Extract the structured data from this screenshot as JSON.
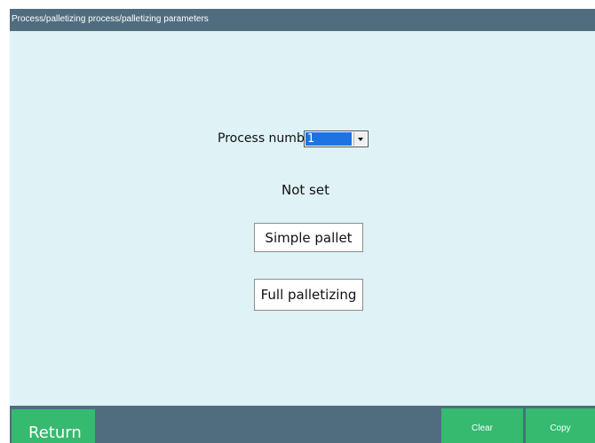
{
  "title_bar": {
    "title": "Process/palletizing process/palletizing parameters"
  },
  "main": {
    "process_label": "Process number",
    "process_select": {
      "value": "1"
    },
    "status_text": "Not set",
    "simple_pallet_label": "Simple pallet",
    "full_palletizing_label": "Full palletizing"
  },
  "bottom_bar": {
    "return_label": "Return",
    "clear_label": "Clear",
    "copy_label": "Copy"
  },
  "colors": {
    "title_bar": "#4f6d7f",
    "content_background": "#dff2f5",
    "button_green": "#35ba6f",
    "selection_blue": "#1f73e0"
  }
}
